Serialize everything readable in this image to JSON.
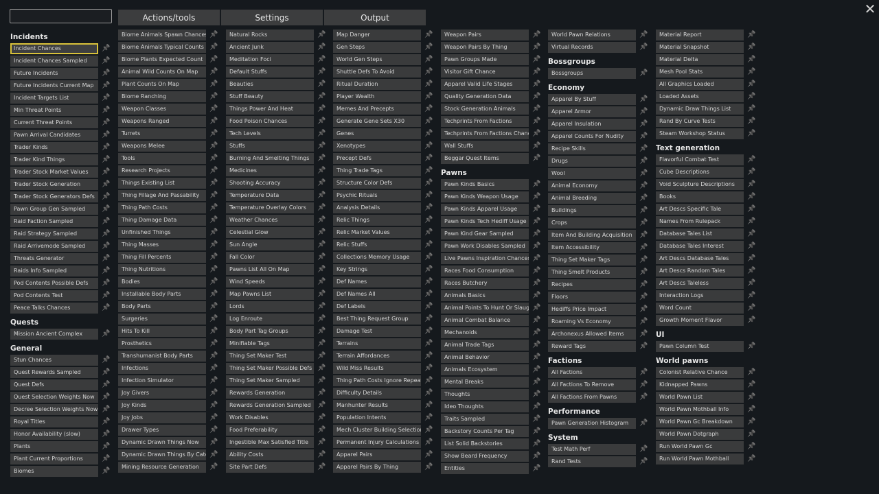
{
  "search": {
    "value": "",
    "placeholder": ""
  },
  "tabs": [
    "Actions/tools",
    "Settings",
    "Output"
  ],
  "close_symbol": "✕",
  "pin_icon": "pin-icon",
  "columns": [
    [
      {
        "header": "Incidents"
      },
      {
        "label": "Incident Chances",
        "selected": true
      },
      {
        "label": "Incident Chances Sampled"
      },
      {
        "label": "Future Incidents"
      },
      {
        "label": "Future Incidents Current Map"
      },
      {
        "label": "Incident Targets List"
      },
      {
        "label": "Min Threat Points"
      },
      {
        "label": "Current Threat Points"
      },
      {
        "label": "Pawn Arrival Candidates"
      },
      {
        "label": "Trader Kinds"
      },
      {
        "label": "Trader Kind Things"
      },
      {
        "label": "Trader Stock Market Values"
      },
      {
        "label": "Trader Stock Generation"
      },
      {
        "label": "Trader Stock Generators Defs"
      },
      {
        "label": "Pawn Group Gen Sampled"
      },
      {
        "label": "Raid Faction Sampled"
      },
      {
        "label": "Raid Strategy Sampled"
      },
      {
        "label": "Raid Arrivemode Sampled"
      },
      {
        "label": "Threats Generator"
      },
      {
        "label": "Raids Info Sampled"
      },
      {
        "label": "Pod Contents Possible Defs"
      },
      {
        "label": "Pod Contents Test"
      },
      {
        "label": "Peace Talks Chances"
      },
      {
        "header": "Quests"
      },
      {
        "label": "Mission Ancient Complex"
      },
      {
        "header": "General"
      },
      {
        "label": "Stun Chances"
      },
      {
        "label": "Quest Rewards Sampled"
      },
      {
        "label": "Quest Defs"
      },
      {
        "label": "Quest Selection Weights Now"
      },
      {
        "label": "Decree Selection Weights Now"
      },
      {
        "label": "Royal Titles"
      },
      {
        "label": "Honor Availability (slow)"
      },
      {
        "label": "Plants"
      },
      {
        "label": "Plant Current Proportions"
      },
      {
        "label": "Biomes"
      }
    ],
    [
      {
        "label": "Biome Animals Spawn Chances"
      },
      {
        "label": "Biome Animals Typical Counts"
      },
      {
        "label": "Biome Plants Expected Count"
      },
      {
        "label": "Animal Wild Counts On Map"
      },
      {
        "label": "Plant Counts On Map"
      },
      {
        "label": "Biome Ranching"
      },
      {
        "label": "Weapon Classes"
      },
      {
        "label": "Weapons Ranged"
      },
      {
        "label": "Turrets"
      },
      {
        "label": "Weapons Melee"
      },
      {
        "label": "Tools"
      },
      {
        "label": "Research Projects"
      },
      {
        "label": "Things Existing List"
      },
      {
        "label": "Thing Fillage And Passability"
      },
      {
        "label": "Thing Path Costs"
      },
      {
        "label": "Thing Damage Data"
      },
      {
        "label": "Unfinished Things"
      },
      {
        "label": "Thing Masses"
      },
      {
        "label": "Thing Fill Percents"
      },
      {
        "label": "Thing Nutritions"
      },
      {
        "label": "Bodies"
      },
      {
        "label": "Installable Body Parts"
      },
      {
        "label": "Body Parts"
      },
      {
        "label": "Surgeries"
      },
      {
        "label": "Hits To Kill"
      },
      {
        "label": "Prosthetics"
      },
      {
        "label": "Transhumanist Body Parts"
      },
      {
        "label": "Infections"
      },
      {
        "label": "Infection Simulator"
      },
      {
        "label": "Joy Givers"
      },
      {
        "label": "Joy Kinds"
      },
      {
        "label": "Joy Jobs"
      },
      {
        "label": "Drawer Types"
      },
      {
        "label": "Dynamic Drawn Things Now"
      },
      {
        "label": "Dynamic Drawn Things By Category"
      },
      {
        "label": "Mining Resource Generation"
      }
    ],
    [
      {
        "label": "Natural Rocks"
      },
      {
        "label": "Ancient Junk"
      },
      {
        "label": "Meditation Foci"
      },
      {
        "label": "Default Stuffs"
      },
      {
        "label": "Beauties"
      },
      {
        "label": "Stuff Beauty"
      },
      {
        "label": "Things Power And Heat"
      },
      {
        "label": "Food Poison Chances"
      },
      {
        "label": "Tech Levels"
      },
      {
        "label": "Stuffs"
      },
      {
        "label": "Burning And Smelting Things"
      },
      {
        "label": "Medicines"
      },
      {
        "label": "Shooting Accuracy"
      },
      {
        "label": "Temperature Data"
      },
      {
        "label": "Temperature Overlay Colors"
      },
      {
        "label": "Weather Chances"
      },
      {
        "label": "Celestial Glow"
      },
      {
        "label": "Sun Angle"
      },
      {
        "label": "Fall Color"
      },
      {
        "label": "Pawns List All On Map"
      },
      {
        "label": "Wind Speeds"
      },
      {
        "label": "Map Pawns List"
      },
      {
        "label": "Lords"
      },
      {
        "label": "Log Enroute"
      },
      {
        "label": "Body Part Tag Groups"
      },
      {
        "label": "Minifiable Tags"
      },
      {
        "label": "Thing Set Maker Test"
      },
      {
        "label": "Thing Set Maker Possible Defs"
      },
      {
        "label": "Thing Set Maker Sampled"
      },
      {
        "label": "Rewards Generation"
      },
      {
        "label": "Rewards Generation Sampled"
      },
      {
        "label": "Work Disables"
      },
      {
        "label": "Food Preferability"
      },
      {
        "label": "Ingestible Max Satisfied Title"
      },
      {
        "label": "Ability Costs"
      },
      {
        "label": "Site Part Defs"
      }
    ],
    [
      {
        "label": "Map Danger"
      },
      {
        "label": "Gen Steps"
      },
      {
        "label": "World Gen Steps"
      },
      {
        "label": "Shuttle Defs To Avoid"
      },
      {
        "label": "Ritual Duration"
      },
      {
        "label": "Player Wealth"
      },
      {
        "label": "Memes And Precepts"
      },
      {
        "label": "Generate Gene Sets X30"
      },
      {
        "label": "Genes"
      },
      {
        "label": "Xenotypes"
      },
      {
        "label": "Precept Defs"
      },
      {
        "label": "Thing Trade Tags"
      },
      {
        "label": "Structure Color Defs"
      },
      {
        "label": "Psychic Rituals"
      },
      {
        "label": "Analysis Details"
      },
      {
        "label": "Relic Things"
      },
      {
        "label": "Relic Market Values"
      },
      {
        "label": "Relic Stuffs"
      },
      {
        "label": "Collections Memory Usage"
      },
      {
        "label": "Key Strings"
      },
      {
        "label": "Def Names"
      },
      {
        "label": "Def Names All"
      },
      {
        "label": "Def Labels"
      },
      {
        "label": "Best Thing Request Group"
      },
      {
        "label": "Damage Test"
      },
      {
        "label": "Terrains"
      },
      {
        "label": "Terrain Affordances"
      },
      {
        "label": "Wild Miss Results"
      },
      {
        "label": "Thing Path Costs Ignore Repeaters"
      },
      {
        "label": "Difficulty Details"
      },
      {
        "label": "Manhunter Results"
      },
      {
        "label": "Population Intents"
      },
      {
        "label": "Mech Cluster Building Selection"
      },
      {
        "label": "Permanent Injury Calculations"
      },
      {
        "label": "Apparel Pairs"
      },
      {
        "label": "Apparel Pairs By Thing"
      }
    ],
    [
      {
        "label": "Weapon Pairs"
      },
      {
        "label": "Weapon Pairs By Thing"
      },
      {
        "label": "Pawn Groups Made"
      },
      {
        "label": "Visitor Gift Chance"
      },
      {
        "label": "Apparel Valid Life Stages"
      },
      {
        "label": "Quality Generation Data"
      },
      {
        "label": "Stock Generation Animals"
      },
      {
        "label": "Techprints From Factions"
      },
      {
        "label": "Techprints From Factions Chance"
      },
      {
        "label": "Wall Stuffs"
      },
      {
        "label": "Beggar Quest Items"
      },
      {
        "header": "Pawns"
      },
      {
        "label": "Pawn Kinds Basics"
      },
      {
        "label": "Pawn Kinds Weapon Usage"
      },
      {
        "label": "Pawn Kinds Apparel Usage"
      },
      {
        "label": "Pawn Kinds Tech Hediff Usage"
      },
      {
        "label": "Pawn Kind Gear Sampled"
      },
      {
        "label": "Pawn Work Disables Sampled"
      },
      {
        "label": "Live Pawns Inspiration Chances"
      },
      {
        "label": "Races Food Consumption"
      },
      {
        "label": "Races Butchery"
      },
      {
        "label": "Animals Basics"
      },
      {
        "label": "Animal Points To Hunt Or Slaughter"
      },
      {
        "label": "Animal Combat Balance"
      },
      {
        "label": "Mechanoids"
      },
      {
        "label": "Animal Trade Tags"
      },
      {
        "label": "Animal Behavior"
      },
      {
        "label": "Animals Ecosystem"
      },
      {
        "label": "Mental Breaks"
      },
      {
        "label": "Thoughts"
      },
      {
        "label": "Ideo Thoughts"
      },
      {
        "label": "Traits Sampled"
      },
      {
        "label": "Backstory Counts Per Tag"
      },
      {
        "label": "List Solid Backstories"
      },
      {
        "label": "Show Beard Frequency"
      },
      {
        "label": "Entities"
      }
    ],
    [
      {
        "label": "World Pawn Relations"
      },
      {
        "label": "Virtual Records"
      },
      {
        "header": "Bossgroups"
      },
      {
        "label": "Bossgroups"
      },
      {
        "header": "Economy"
      },
      {
        "label": "Apparel By Stuff"
      },
      {
        "label": "Apparel Armor"
      },
      {
        "label": "Apparel Insulation"
      },
      {
        "label": "Apparel Counts For Nudity"
      },
      {
        "label": "Recipe Skills"
      },
      {
        "label": "Drugs"
      },
      {
        "label": "Wool"
      },
      {
        "label": "Animal Economy"
      },
      {
        "label": "Animal Breeding"
      },
      {
        "label": "Buildings"
      },
      {
        "label": "Crops"
      },
      {
        "label": "Item And Building Acquisition"
      },
      {
        "label": "Item Accessibility"
      },
      {
        "label": "Thing Set Maker Tags"
      },
      {
        "label": "Thing Smelt Products"
      },
      {
        "label": "Recipes"
      },
      {
        "label": "Floors"
      },
      {
        "label": "Hediffs Price Impact"
      },
      {
        "label": "Roaming Vs Economy"
      },
      {
        "label": "Archonexus Allowed Items"
      },
      {
        "label": "Reward Tags"
      },
      {
        "header": "Factions"
      },
      {
        "label": "All Factions"
      },
      {
        "label": "All Factions To Remove"
      },
      {
        "label": "All Factions From Pawns"
      },
      {
        "header": "Performance"
      },
      {
        "label": "Pawn Generation Histogram"
      },
      {
        "header": "System"
      },
      {
        "label": "Test Math Perf"
      },
      {
        "label": "Rand Tests"
      }
    ],
    [
      {
        "label": "Material Report"
      },
      {
        "label": "Material Snapshot"
      },
      {
        "label": "Material Delta"
      },
      {
        "label": "Mesh Pool Stats"
      },
      {
        "label": "All Graphics Loaded"
      },
      {
        "label": "Loaded Assets"
      },
      {
        "label": "Dynamic Draw Things List"
      },
      {
        "label": "Rand By Curve Tests"
      },
      {
        "label": "Steam Workshop Status"
      },
      {
        "header": "Text generation"
      },
      {
        "label": "Flavorful Combat Test"
      },
      {
        "label": "Cube Descriptions"
      },
      {
        "label": "Void Sculpture Descriptions"
      },
      {
        "label": "Books"
      },
      {
        "label": "Art Descs Specific Tale"
      },
      {
        "label": "Names From Rulepack"
      },
      {
        "label": "Database Tales List"
      },
      {
        "label": "Database Tales Interest"
      },
      {
        "label": "Art Descs Database Tales"
      },
      {
        "label": "Art Descs Random Tales"
      },
      {
        "label": "Art Descs Taleless"
      },
      {
        "label": "Interaction Logs"
      },
      {
        "label": "Word Count"
      },
      {
        "label": "Growth Moment Flavor"
      },
      {
        "header": "UI"
      },
      {
        "label": "Pawn Column Test"
      },
      {
        "header": "World pawns"
      },
      {
        "label": "Colonist Relative Chance"
      },
      {
        "label": "Kidnapped Pawns"
      },
      {
        "label": "World Pawn List"
      },
      {
        "label": "World Pawn Mothball Info"
      },
      {
        "label": "World Pawn Gc Breakdown"
      },
      {
        "label": "World Pawn Dotgraph"
      },
      {
        "label": "Run World Pawn Gc"
      },
      {
        "label": "Run World Pawn Mothball"
      }
    ]
  ]
}
